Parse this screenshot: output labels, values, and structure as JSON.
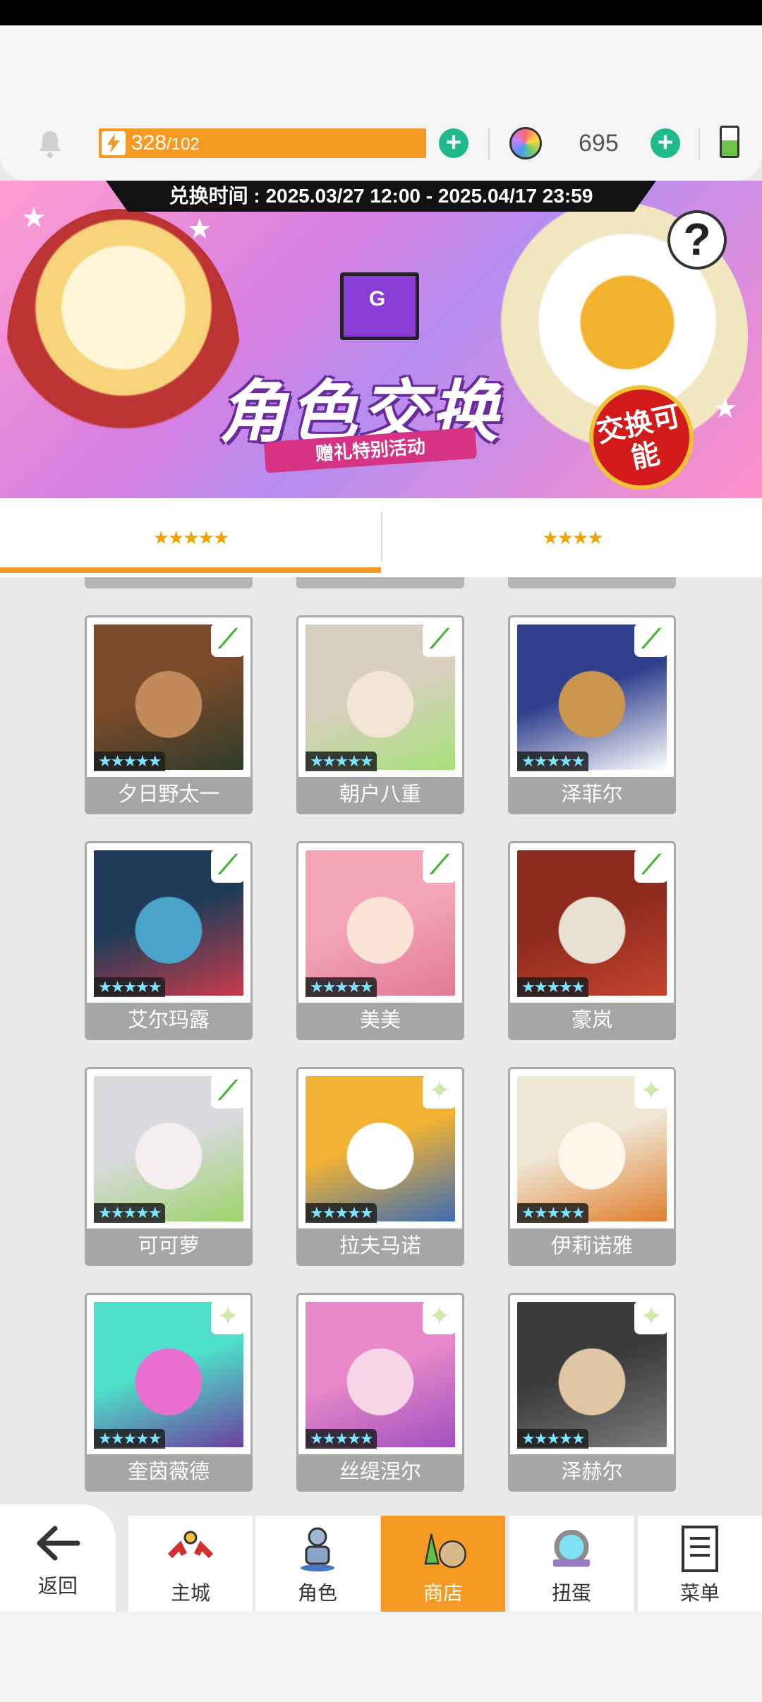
{
  "resources": {
    "stamina": "328",
    "stamina_max": "/102",
    "gems": "695"
  },
  "banner": {
    "date_range": "兑换时间 : 2025.03/27 12:00 - 2025.04/17 23:59",
    "title": "角色交换",
    "subtitle": "赠礼特别活动",
    "badge": "交换可能",
    "help": "?"
  },
  "tabs": [
    {
      "label": "★★★★★"
    },
    {
      "label": "★★★★"
    }
  ],
  "cards": [
    {
      "name": "夕日野太一",
      "stars": "★★★★★",
      "colors": [
        "#7b4a2a",
        "#c08a5a",
        "#2e3b2a"
      ]
    },
    {
      "name": "朝户八重",
      "stars": "★★★★★",
      "colors": [
        "#d9cfc0",
        "#f3e3d2",
        "#a7e07a"
      ]
    },
    {
      "name": "泽菲尔",
      "stars": "★★★★★",
      "colors": [
        "#2f3f8e",
        "#c9954f",
        "#ffffff"
      ]
    },
    {
      "name": "艾尔玛露",
      "stars": "★★★★★",
      "colors": [
        "#1f3b57",
        "#4aa3c8",
        "#c83b4a"
      ]
    },
    {
      "name": "美美",
      "stars": "★★★★★",
      "colors": [
        "#f4a6b8",
        "#fbe3d6",
        "#e07a95"
      ]
    },
    {
      "name": "豪岚",
      "stars": "★★★★★",
      "colors": [
        "#8c2a1e",
        "#e8e0d0",
        "#c4432f"
      ]
    },
    {
      "name": "可可萝",
      "stars": "★★★★★",
      "colors": [
        "#d9d9de",
        "#f5eef0",
        "#9cd36b"
      ]
    },
    {
      "name": "拉夫马诺",
      "stars": "★★★★★",
      "colors": [
        "#f2b233",
        "#ffffff",
        "#3d6db5"
      ]
    },
    {
      "name": "伊莉诺雅",
      "stars": "★★★★★",
      "colors": [
        "#efe6d4",
        "#fff5ea",
        "#e07f2e"
      ]
    },
    {
      "name": "奎茵薇德",
      "stars": "★★★★★",
      "colors": [
        "#4fe0c9",
        "#e86fd0",
        "#6b3fa0"
      ]
    },
    {
      "name": "丝缇涅尔",
      "stars": "★★★★★",
      "colors": [
        "#e889c9",
        "#f8d6e8",
        "#a24fbf"
      ]
    },
    {
      "name": "泽赫尔",
      "stars": "★★★★★",
      "colors": [
        "#3b3b3b",
        "#e0c6a6",
        "#7b7b7b"
      ]
    }
  ],
  "nav": {
    "back": "返回",
    "items": [
      {
        "label": "主城",
        "icon": "castle-icon"
      },
      {
        "label": "角色",
        "icon": "character-icon"
      },
      {
        "label": "商店",
        "icon": "shop-icon"
      },
      {
        "label": "扭蛋",
        "icon": "gacha-icon"
      },
      {
        "label": "菜单",
        "icon": "menu-icon"
      }
    ]
  },
  "colors": {
    "accent": "#f59a23",
    "plus": "#1fb98c",
    "card_name_bg": "#a6a6a6"
  }
}
